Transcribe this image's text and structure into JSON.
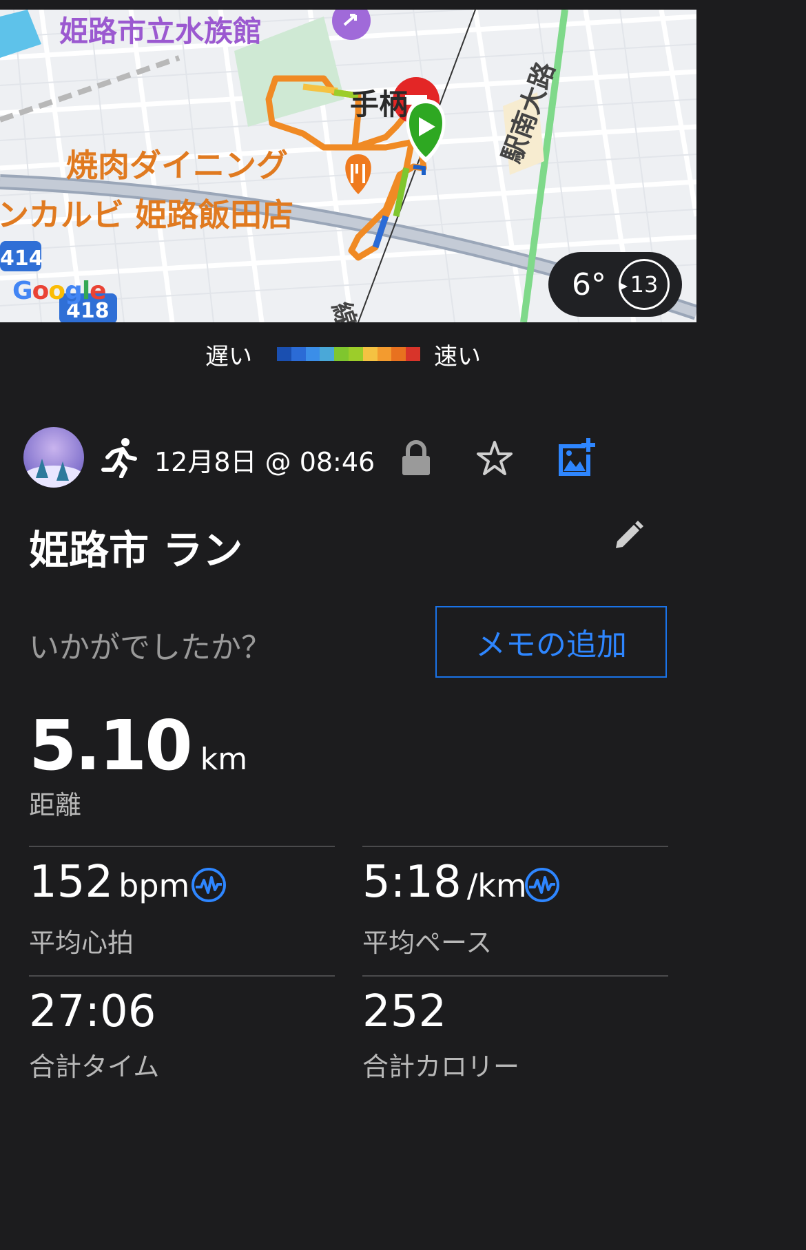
{
  "map": {
    "poi_aquarium": "姫路市立水族館",
    "poi_restaurant_line1": "焼肉ダイニング",
    "poi_restaurant_line2": "ンカルビ 姫路飯田店",
    "station_partial": "手柄",
    "road_label": "駅南大路",
    "rail_label": "線",
    "route_badge_1": "414",
    "route_badge_2": "418",
    "google_logo": "Google",
    "weather": {
      "temperature": "6°",
      "wind": "13"
    },
    "route_colors": {
      "slow": "#1b5fc7",
      "mid": "#7fc62e",
      "fast": "#e23a2a",
      "orange": "#f08a24"
    }
  },
  "legend": {
    "slow_label": "遅い",
    "fast_label": "速い",
    "colors": [
      "#1a4fb0",
      "#2b6bd6",
      "#3b8ee8",
      "#4aa8d8",
      "#7fc62e",
      "#9ccd2a",
      "#f5c242",
      "#f39b2f",
      "#e8711f",
      "#d8342a"
    ]
  },
  "activity": {
    "datetime": "12月8日 @ 08:46",
    "title": "姫路市 ラン",
    "prompt": "いかがでしたか？",
    "memo_button": "メモの追加",
    "icons": [
      "avatar",
      "running-icon",
      "lock-icon",
      "star-icon",
      "add-photo-icon",
      "edit-pencil-icon"
    ]
  },
  "stats": {
    "distance": {
      "value": "5.10",
      "unit": "km",
      "label": "距離"
    },
    "heart_rate": {
      "value": "152",
      "unit": "bpm",
      "label": "平均心拍"
    },
    "pace": {
      "value": "5:18",
      "unit": "/km",
      "label": "平均ペース"
    },
    "total_time": {
      "value": "27:06",
      "label": "合計タイム"
    },
    "calories": {
      "value": "252",
      "label": "合計カロリー"
    }
  },
  "accent_color": "#1a73e8"
}
